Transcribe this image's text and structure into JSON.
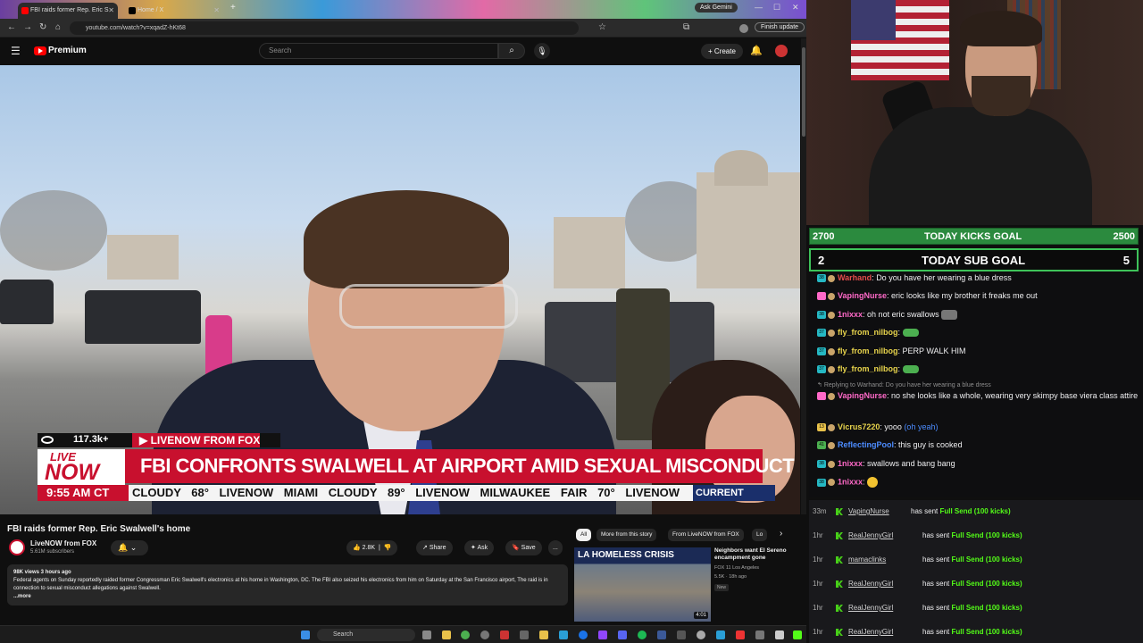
{
  "browser": {
    "tabs": [
      {
        "label": "FBI raids former Rep. Eric S",
        "active": true
      },
      {
        "label": "Home / X",
        "active": false
      }
    ],
    "ask_gemini": "Ask Gemini",
    "url": "youtube.com/watch?v=xqadZ-hKt68",
    "finish_update": "Finish update"
  },
  "youtube": {
    "logo": "Premium",
    "search_placeholder": "Search",
    "create_label": "Create",
    "video": {
      "viewers": "117.3k+",
      "network_label": "LIVENOW FROM FOX",
      "live_line1": "LIVE",
      "live_line2": "NOW",
      "headline": "FBI CONFRONTS SWALWELL AT AIRPORT AMID SEXUAL MISCONDUCT PROBE",
      "time": "9:55 AM CT",
      "ticker": "CLOUDY 68°   LIVENOW   MIAMI  CLOUDY 89°   LIVENOW   MILWAUKEE  FAIR 70°   LIVENOW",
      "current_temps": "CURRENT TEMPS"
    },
    "title": "FBI raids former Rep. Eric Swalwell's home",
    "channel": {
      "name": "LiveNOW from FOX",
      "subscribers": "5.61M subscribers"
    },
    "actions": {
      "likes": "2.8K",
      "share": "Share",
      "ask": "Ask",
      "save": "Save",
      "more": "..."
    },
    "description": {
      "meta": "98K views  3 hours ago",
      "text": "Federal agents on Sunday reportedly raided former Congressman Eric Swalwell's electronics at his home in Washington, DC. The FBI also seized his electronics from him on Saturday at the San Francisco airport, The raid is in connection to sexual misconduct allegations against Swalwell.",
      "more": "...more"
    },
    "chips": [
      "All",
      "More from this story",
      "From LiveNOW from FOX",
      "Lo"
    ],
    "recommendation": {
      "thumb_label": "LA HOMELESS CRISIS",
      "duration": "4:01",
      "title": "Neighbors want El Sereno encampment gone",
      "channel": "FOX 11 Los Angeles",
      "views": "5.5K · 18h ago",
      "badge": "New"
    }
  },
  "taskbar": {
    "search": "Search"
  },
  "stream": {
    "kicks_goal": {
      "left": "2700",
      "label": "TODAY KICKS GOAL",
      "right": "2500"
    },
    "sub_goal": {
      "left": "2",
      "label": "TODAY SUB GOAL",
      "right": "5"
    },
    "chat": [
      {
        "badge": "38",
        "user": "Warhand",
        "color": "#e44c4c",
        "text": "Do you have her wearing a blue dress"
      },
      {
        "badge": "",
        "user": "VapingNurse",
        "color": "#ff69c8",
        "text": "eric looks like my brother it freaks me out"
      },
      {
        "badge": "38",
        "user": "1nixxx",
        "color": "#ff69c8",
        "text": "oh not eric swallows"
      },
      {
        "badge": "37",
        "user": "fly_from_nilbog",
        "color": "#e8d44c",
        "text": ""
      },
      {
        "badge": "37",
        "user": "fly_from_nilbog",
        "color": "#e8d44c",
        "text": "PERP WALK HIM"
      },
      {
        "badge": "37",
        "user": "fly_from_nilbog",
        "color": "#e8d44c",
        "text": ""
      },
      {
        "badge": "",
        "user": "VapingNurse",
        "color": "#ff69c8",
        "text": "no she looks like a whole, wearing very skimpy base viera class attire"
      },
      {
        "badge": "13",
        "user": "Vicrus7220",
        "color": "#e8d44c",
        "text": "yooo",
        "extra": "(oh yeah)"
      },
      {
        "badge": "41",
        "user": "ReflectingPool",
        "color": "#4c8cff",
        "text": "this guy is cooked"
      },
      {
        "badge": "38",
        "user": "1nixxx",
        "color": "#ff69c8",
        "text": "swallows and bang bang"
      },
      {
        "badge": "38",
        "user": "1nixxx",
        "color": "#ff69c8",
        "text": ""
      }
    ],
    "reply_line": "Replying to Warhand: Do you have her wearing a blue dress",
    "events": [
      {
        "time": "33m",
        "user": "VapingNurse",
        "action": "has sent",
        "item": "Full Send (100 kicks)"
      },
      {
        "time": "1hr",
        "user": "RealJennyGirl",
        "action": "has sent",
        "item": "Full Send (100 kicks)"
      },
      {
        "time": "1hr",
        "user": "mamaclinks",
        "action": "has sent",
        "item": "Full Send (100 kicks)"
      },
      {
        "time": "1hr",
        "user": "RealJennyGirl",
        "action": "has sent",
        "item": "Full Send (100 kicks)"
      },
      {
        "time": "1hr",
        "user": "RealJennyGirl",
        "action": "has sent",
        "item": "Full Send (100 kicks)"
      },
      {
        "time": "1hr",
        "user": "RealJennyGirl",
        "action": "has sent",
        "item": "Full Send (100 kicks)"
      }
    ]
  }
}
